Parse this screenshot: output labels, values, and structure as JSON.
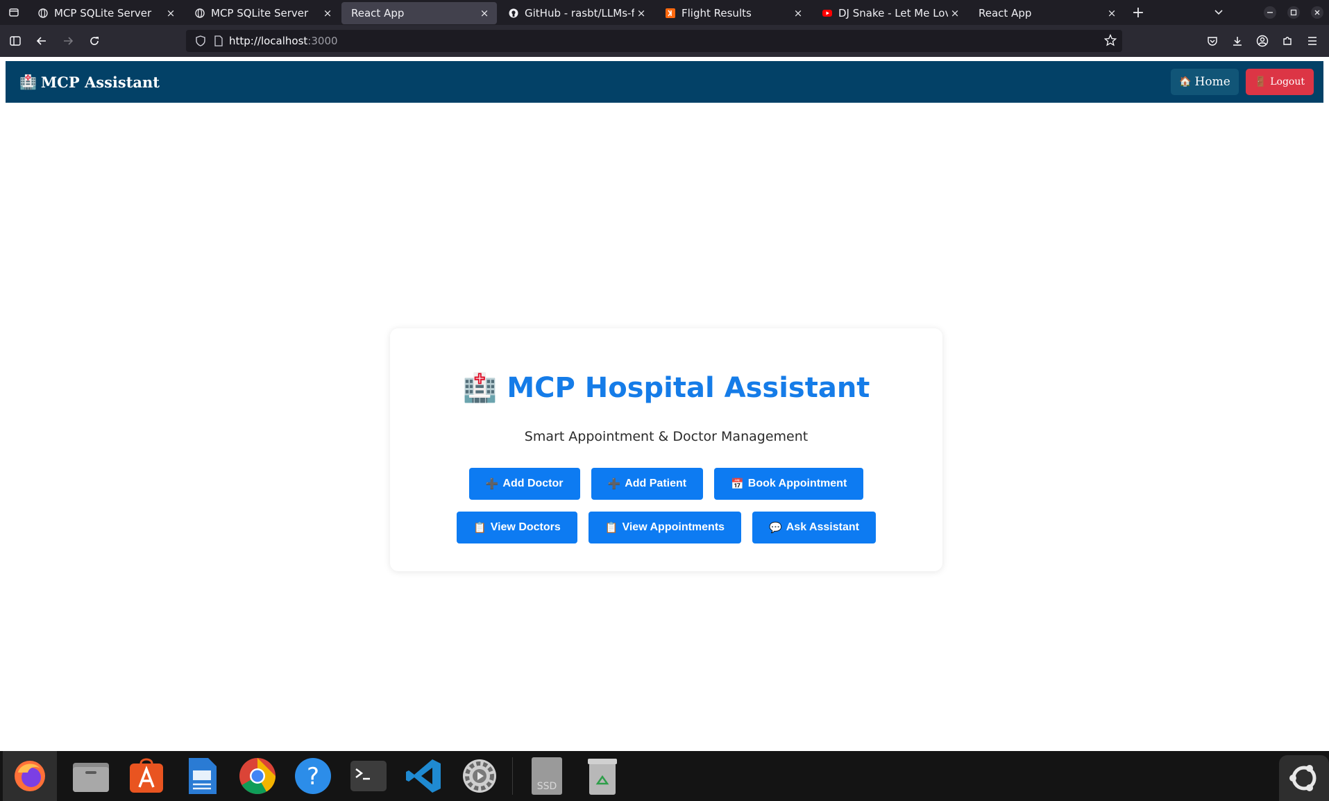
{
  "browser": {
    "tabs": [
      {
        "title": "MCP SQLite Server",
        "favicon": "globe-icon",
        "active": false
      },
      {
        "title": "MCP SQLite Server",
        "favicon": "globe-icon",
        "active": false
      },
      {
        "title": "React App",
        "favicon": "",
        "active": true
      },
      {
        "title": "GitHub - rasbt/LLMs-from",
        "favicon": "github-icon",
        "active": false
      },
      {
        "title": "Flight Results",
        "favicon": "kayak-icon",
        "active": false
      },
      {
        "title": "DJ Snake - Let Me Love Yo",
        "favicon": "youtube-icon",
        "active": false
      },
      {
        "title": "React App",
        "favicon": "",
        "active": false
      }
    ],
    "close_glyph": "×",
    "new_tab_glyph": "+",
    "url_host": "http://localhost",
    "url_rest": ":3000"
  },
  "app": {
    "brand_icon": "🏥",
    "brand_label": "MCP Assistant",
    "nav": {
      "home_icon": "🏠",
      "home_label": "Home",
      "logout_icon": "🚪",
      "logout_label": "Logout"
    },
    "card": {
      "title_icon": "🏥",
      "title": "MCP Hospital Assistant",
      "subtitle": "Smart Appointment & Doctor Management"
    },
    "actions_row1": [
      {
        "icon": "➕",
        "label": "Add Doctor"
      },
      {
        "icon": "➕",
        "label": "Add Patient"
      },
      {
        "icon": "📅",
        "label": "Book Appointment"
      }
    ],
    "actions_row2": [
      {
        "icon": "📋",
        "label": "View Doctors"
      },
      {
        "icon": "📋",
        "label": "View Appointments"
      },
      {
        "icon": "💬",
        "label": "Ask Assistant"
      }
    ]
  },
  "colors": {
    "navbar": "#034167",
    "primary": "#0d7bf2",
    "title": "#157ce8",
    "logout": "#dc3545"
  }
}
